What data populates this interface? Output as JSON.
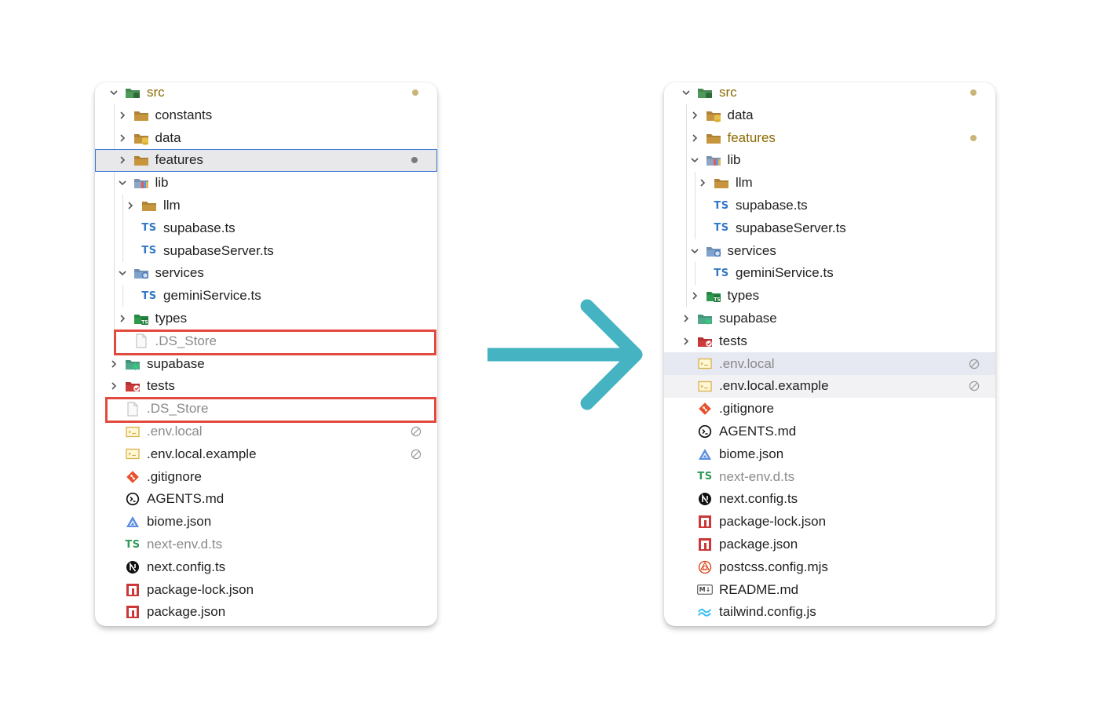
{
  "left_panel": {
    "rows": [
      {
        "label": "src",
        "chevron": "down",
        "icon": "folder-src-icon",
        "depth": 0,
        "git": "modified",
        "dot": true
      },
      {
        "label": "constants",
        "chevron": "right",
        "icon": "folder-icon",
        "depth": 1
      },
      {
        "label": "data",
        "chevron": "right",
        "icon": "folder-data-icon",
        "depth": 1
      },
      {
        "label": "features",
        "chevron": "right",
        "icon": "folder-icon",
        "depth": 1,
        "selected": true,
        "dot": true
      },
      {
        "label": "lib",
        "chevron": "down",
        "icon": "folder-lib-icon",
        "depth": 1
      },
      {
        "label": "llm",
        "chevron": "right",
        "icon": "folder-icon",
        "depth": 2
      },
      {
        "label": "supabase.ts",
        "chevron": "none",
        "icon": "typescript-icon",
        "depth": 2
      },
      {
        "label": "supabaseServer.ts",
        "chevron": "none",
        "icon": "typescript-icon",
        "depth": 2
      },
      {
        "label": "services",
        "chevron": "down",
        "icon": "folder-services-icon",
        "depth": 1
      },
      {
        "label": "geminiService.ts",
        "chevron": "none",
        "icon": "typescript-icon",
        "depth": 2
      },
      {
        "label": "types",
        "chevron": "right",
        "icon": "folder-types-icon",
        "depth": 1
      },
      {
        "label": ".DS_Store",
        "chevron": "none",
        "icon": "file-icon",
        "depth": 1,
        "dim": true,
        "boxed": true
      },
      {
        "label": "supabase",
        "chevron": "right",
        "icon": "folder-supabase-icon",
        "depth": 0
      },
      {
        "label": "tests",
        "chevron": "right",
        "icon": "folder-tests-icon",
        "depth": 0
      },
      {
        "label": ".DS_Store",
        "chevron": "none",
        "icon": "file-icon",
        "depth": 0,
        "dim": true,
        "boxed": true
      },
      {
        "label": ".env.local",
        "chevron": "none",
        "icon": "env-icon",
        "depth": 0,
        "dim": true,
        "ignored": true
      },
      {
        "label": ".env.local.example",
        "chevron": "none",
        "icon": "env-icon",
        "depth": 0,
        "ignored": true
      },
      {
        "label": ".gitignore",
        "chevron": "none",
        "icon": "git-icon",
        "depth": 0
      },
      {
        "label": "AGENTS.md",
        "chevron": "none",
        "icon": "agents-icon",
        "depth": 0
      },
      {
        "label": "biome.json",
        "chevron": "none",
        "icon": "biome-icon",
        "depth": 0
      },
      {
        "label": "next-env.d.ts",
        "chevron": "none",
        "icon": "typescript-def-icon",
        "depth": 0,
        "dim": true
      },
      {
        "label": "next.config.ts",
        "chevron": "none",
        "icon": "nextjs-icon",
        "depth": 0
      },
      {
        "label": "package-lock.json",
        "chevron": "none",
        "icon": "npm-icon",
        "depth": 0
      },
      {
        "label": "package.json",
        "chevron": "none",
        "icon": "npm-icon",
        "depth": 0
      }
    ]
  },
  "right_panel": {
    "rows": [
      {
        "label": "src",
        "chevron": "down",
        "icon": "folder-src-icon",
        "depth": 0,
        "git": "modified",
        "dot": true
      },
      {
        "label": "data",
        "chevron": "right",
        "icon": "folder-data-icon",
        "depth": 1
      },
      {
        "label": "features",
        "chevron": "right",
        "icon": "folder-icon",
        "depth": 1,
        "git": "modified",
        "dot": true
      },
      {
        "label": "lib",
        "chevron": "down",
        "icon": "folder-lib-icon",
        "depth": 1
      },
      {
        "label": "llm",
        "chevron": "right",
        "icon": "folder-icon",
        "depth": 2
      },
      {
        "label": "supabase.ts",
        "chevron": "none",
        "icon": "typescript-icon",
        "depth": 2
      },
      {
        "label": "supabaseServer.ts",
        "chevron": "none",
        "icon": "typescript-icon",
        "depth": 2
      },
      {
        "label": "services",
        "chevron": "down",
        "icon": "folder-services-icon",
        "depth": 1
      },
      {
        "label": "geminiService.ts",
        "chevron": "none",
        "icon": "typescript-icon",
        "depth": 2
      },
      {
        "label": "types",
        "chevron": "right",
        "icon": "folder-types-icon",
        "depth": 1
      },
      {
        "label": "supabase",
        "chevron": "right",
        "icon": "folder-supabase-icon",
        "depth": 0
      },
      {
        "label": "tests",
        "chevron": "right",
        "icon": "folder-tests-icon",
        "depth": 0
      },
      {
        "label": ".env.local",
        "chevron": "none",
        "icon": "env-icon",
        "depth": 0,
        "dim": true,
        "ignored": true,
        "highlight": "blue"
      },
      {
        "label": ".env.local.example",
        "chevron": "none",
        "icon": "env-icon",
        "depth": 0,
        "ignored": true,
        "highlight": "grey"
      },
      {
        "label": ".gitignore",
        "chevron": "none",
        "icon": "git-icon",
        "depth": 0
      },
      {
        "label": "AGENTS.md",
        "chevron": "none",
        "icon": "agents-icon",
        "depth": 0
      },
      {
        "label": "biome.json",
        "chevron": "none",
        "icon": "biome-icon",
        "depth": 0
      },
      {
        "label": "next-env.d.ts",
        "chevron": "none",
        "icon": "typescript-def-icon",
        "depth": 0,
        "dim": true
      },
      {
        "label": "next.config.ts",
        "chevron": "none",
        "icon": "nextjs-icon",
        "depth": 0
      },
      {
        "label": "package-lock.json",
        "chevron": "none",
        "icon": "npm-icon",
        "depth": 0
      },
      {
        "label": "package.json",
        "chevron": "none",
        "icon": "npm-icon",
        "depth": 0
      },
      {
        "label": "postcss.config.mjs",
        "chevron": "none",
        "icon": "postcss-icon",
        "depth": 0
      },
      {
        "label": "README.md",
        "chevron": "none",
        "icon": "markdown-icon",
        "depth": 0
      },
      {
        "label": "tailwind.config.js",
        "chevron": "none",
        "icon": "tailwind-icon",
        "depth": 0
      }
    ]
  },
  "icons": {
    "typescript_badge": "TS",
    "markdown_badge": "M↓"
  },
  "colors": {
    "selection_border": "#3b7ad6",
    "annotation_red": "#e24a3f",
    "arrow_teal": "#45b3c2",
    "git_modified": "#8b6b00"
  }
}
